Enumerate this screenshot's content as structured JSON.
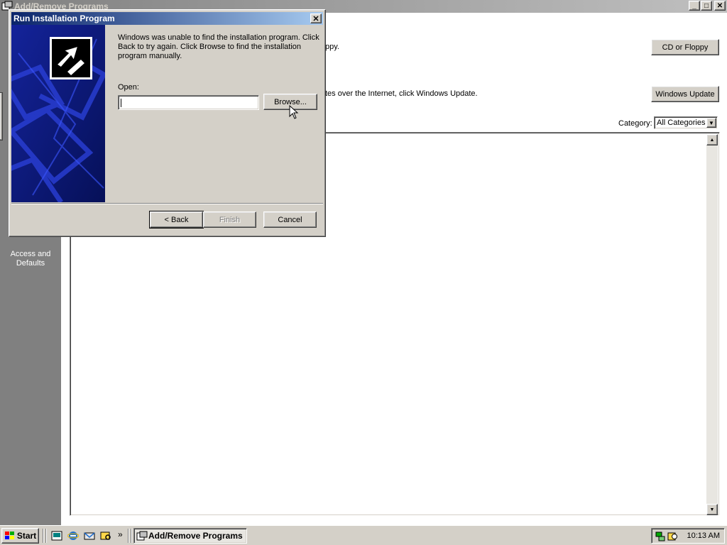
{
  "main_window": {
    "title": "Add/Remove Programs",
    "minimize_label": "_",
    "maximize_label": "□",
    "close_label": "✕"
  },
  "left_panel": {
    "label": "Access and Defaults"
  },
  "content": {
    "cd_text_fragment": "ppy.",
    "update_text_fragment": "tes over the Internet, click Windows Update.",
    "cd_button": "CD or Floppy",
    "update_button": "Windows Update",
    "category_label": "Category:",
    "category_value": "All Categories"
  },
  "dialog": {
    "title": "Run Installation Program",
    "message": "Windows was unable to find the installation program.  Click Back to try again.  Click Browse to find the installation program manually.",
    "open_label": "Open:",
    "open_value": "",
    "browse_button": "Browse...",
    "back_button": "< Back",
    "finish_button": "Finish",
    "cancel_button": "Cancel",
    "close_label": "✕"
  },
  "taskbar": {
    "start_label": "Start",
    "task_label": "Add/Remove Programs",
    "chevron": "»",
    "clock": "10:13 AM"
  }
}
